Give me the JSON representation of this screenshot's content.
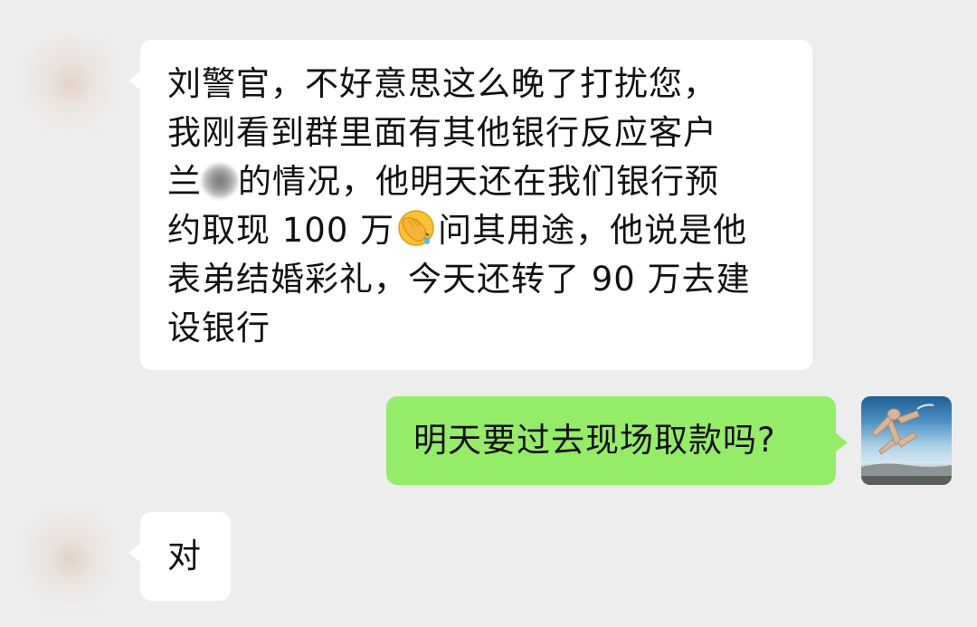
{
  "messages": [
    {
      "from": "contact",
      "lines": [
        "刘警官，不好意思这么晚了打扰您，",
        "我刚看到群里面有其他银行反应客户",
        "兰",
        "的情况，他明天还在我们银行预",
        "约取现 100 万",
        "问其用途，他说是他",
        "表弟结婚彩礼，今天还转了 90 万去建",
        "设银行"
      ],
      "emoji": "facepalm"
    },
    {
      "from": "me",
      "text": "明天要过去现场取款吗?"
    },
    {
      "from": "contact",
      "text": "对"
    }
  ],
  "colors": {
    "background": "#ededed",
    "incoming_bubble": "#ffffff",
    "outgoing_bubble": "#95ec69",
    "text": "#111111"
  },
  "icons": {
    "contact_avatar": "blurred-avatar",
    "my_avatar": "photo-avatar",
    "emoji": "facepalm-emoji",
    "redaction": "blurred-name"
  }
}
